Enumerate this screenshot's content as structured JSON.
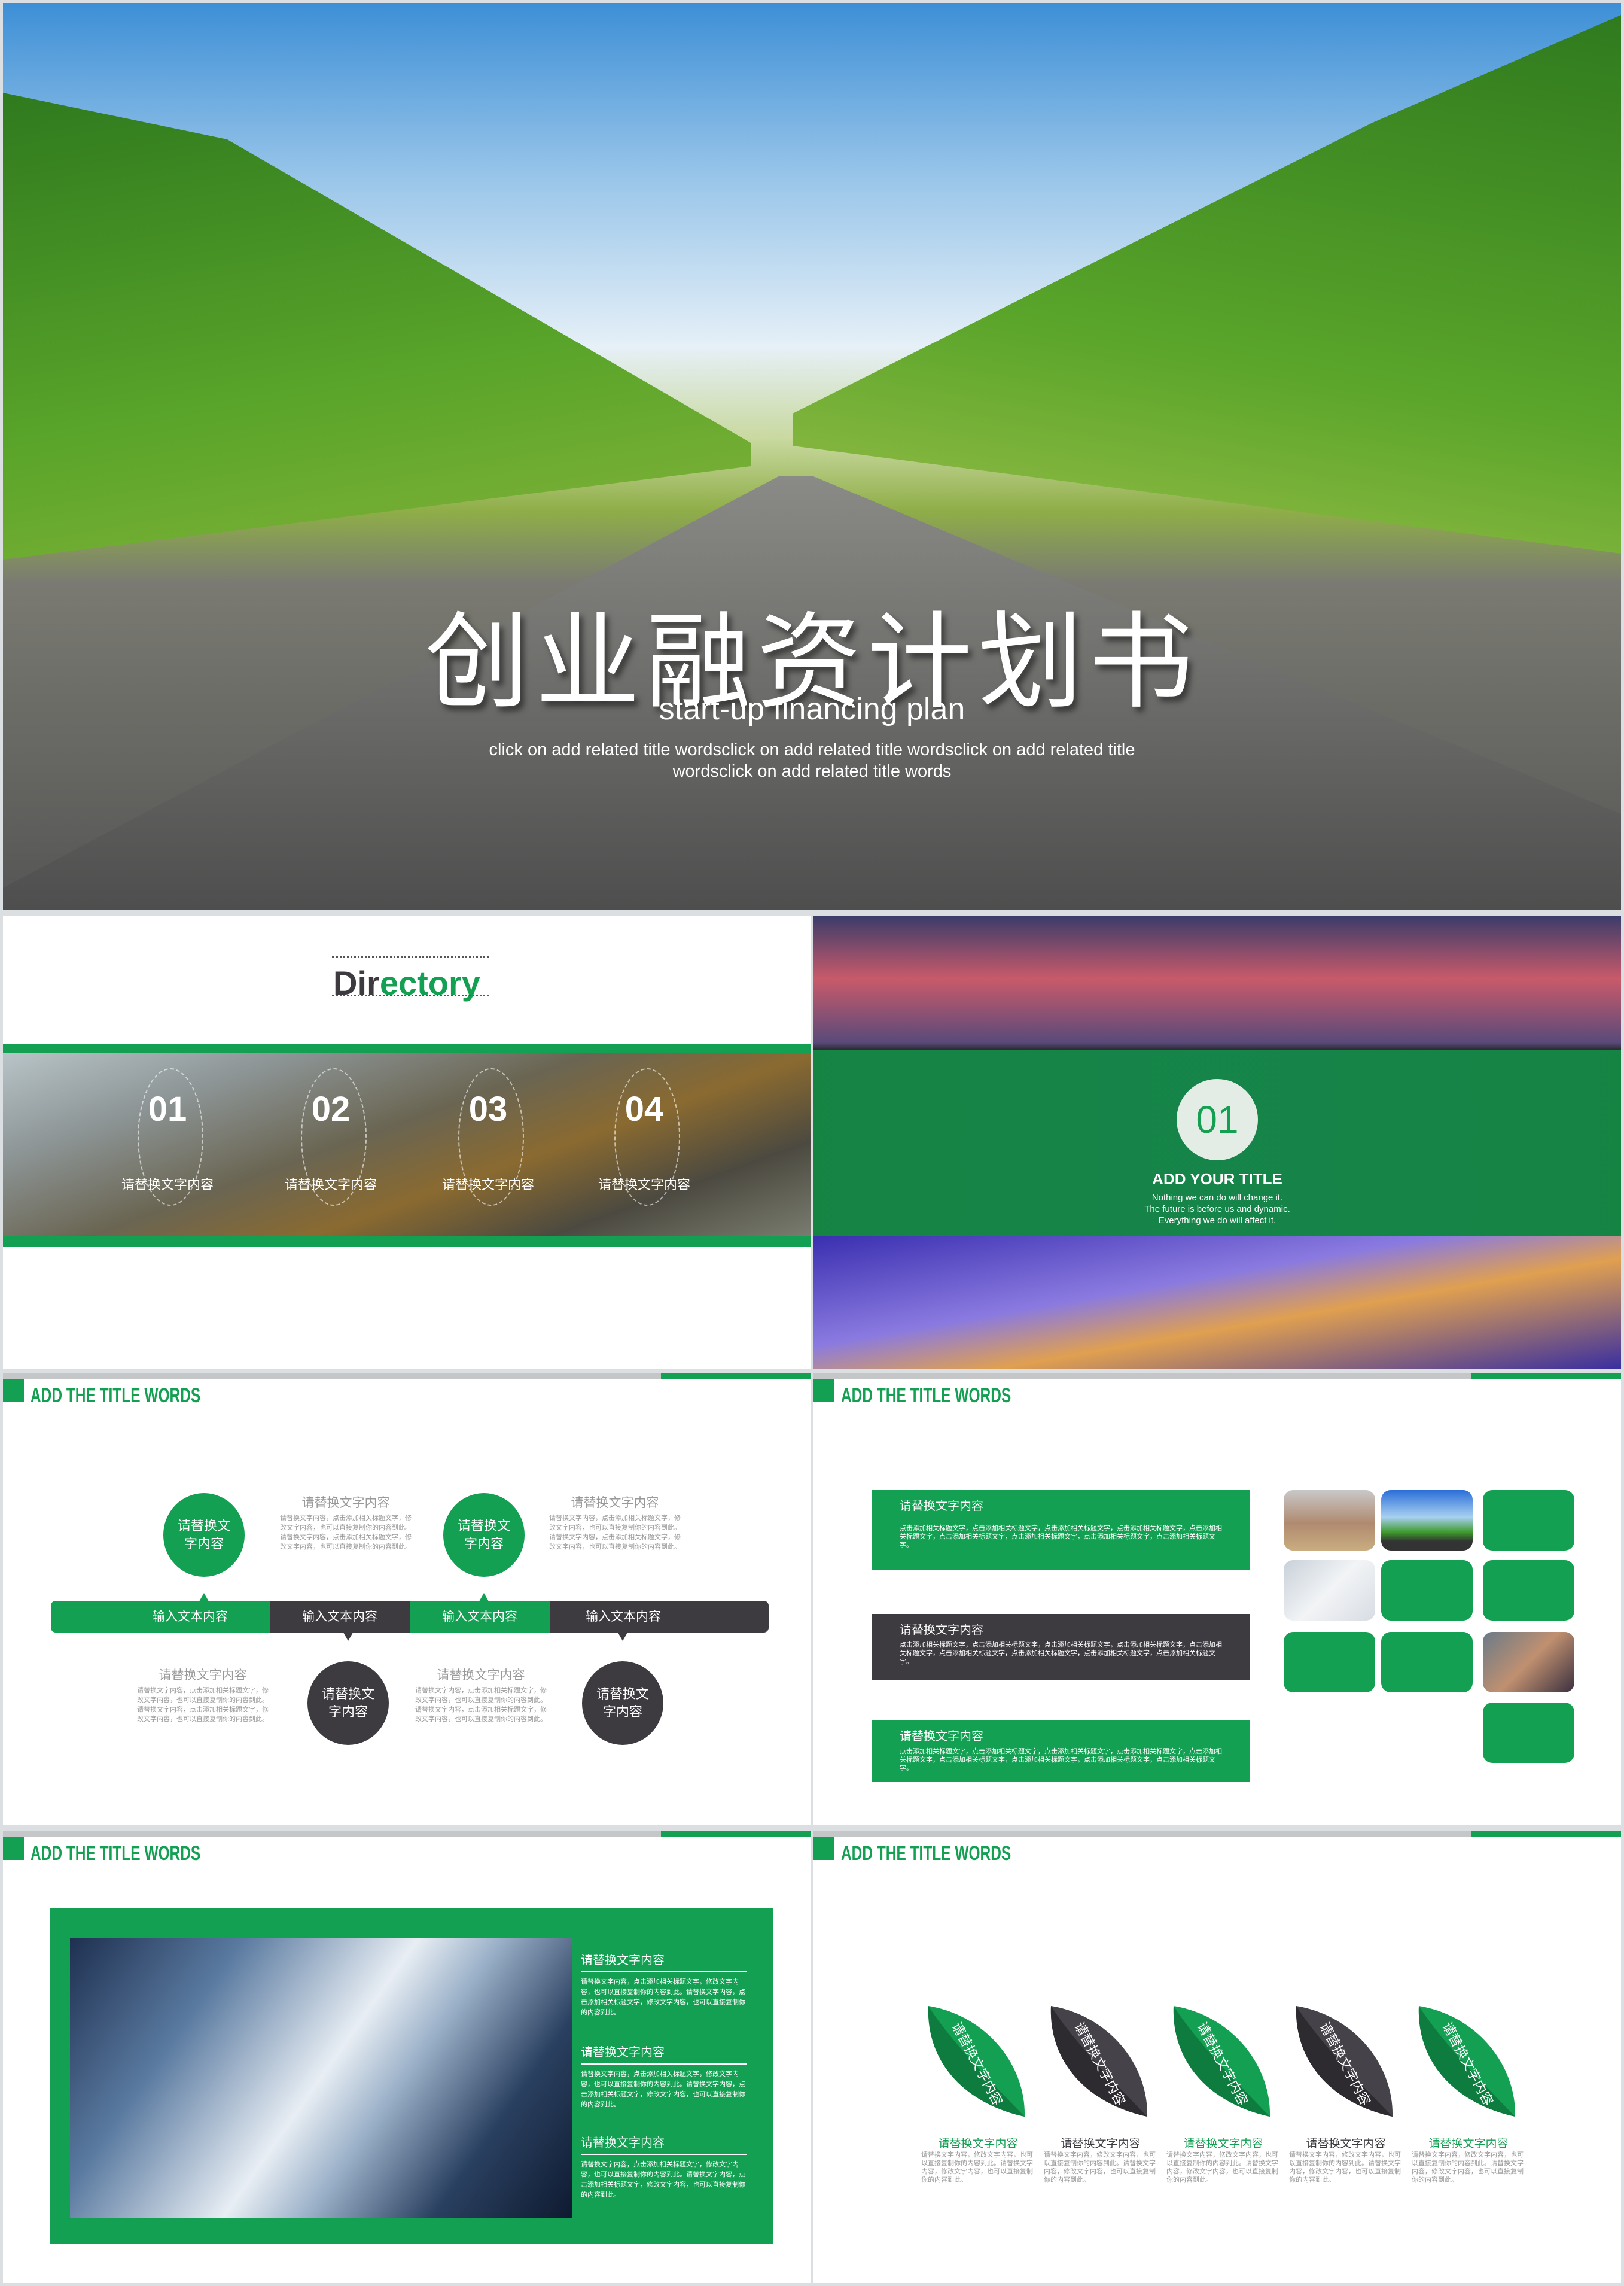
{
  "colors": {
    "accent": "#14a052",
    "dark": "#3e3b40",
    "gray_text": "#999999"
  },
  "cover": {
    "title": "创业融资计划书",
    "subtitle": "start-up financing plan",
    "body_line1": "click on add related title wordsclick on add related title wordsclick on add related title",
    "body_line2": "wordsclick on add related title words"
  },
  "directory": {
    "heading_dark": "Dir",
    "heading_green": "ectory",
    "items": [
      {
        "num": "01",
        "label": "请替换文字内容"
      },
      {
        "num": "02",
        "label": "请替换文字内容"
      },
      {
        "num": "03",
        "label": "请替换文字内容"
      },
      {
        "num": "04",
        "label": "请替换文字内容"
      }
    ]
  },
  "section": {
    "num": "01",
    "title": "ADD YOUR TITLE",
    "lines": [
      "Nothing we can do will change it.",
      "The future is before us and dynamic.",
      "Everything we do will affect it."
    ]
  },
  "timeline": {
    "header": "ADD THE TITLE WORDS",
    "circles_top": [
      "请替换文字内容",
      "请替换文字内容"
    ],
    "circles_bottom": [
      "请替换文字内容",
      "请替换文字内容"
    ],
    "bar_labels": [
      "输入文本内容",
      "输入文本内容",
      "输入文本内容",
      "输入文本内容"
    ],
    "blocks": [
      {
        "title": "请替换文字内容",
        "body": "请替换文字内容，点击添加相关标题文字，修改文字内容，也可以直接复制你的内容到此。请替换文字内容，点击添加相关标题文字，修改文字内容，也可以直接复制你的内容到此。"
      },
      {
        "title": "请替换文字内容",
        "body": "请替换文字内容，点击添加相关标题文字，修改文字内容，也可以直接复制你的内容到此。请替换文字内容，点击添加相关标题文字，修改文字内容，也可以直接复制你的内容到此。"
      },
      {
        "title": "请替换文字内容",
        "body": "请替换文字内容，点击添加相关标题文字，修改文字内容，也可以直接复制你的内容到此。请替换文字内容，点击添加相关标题文字，修改文字内容，也可以直接复制你的内容到此。"
      },
      {
        "title": "请替换文字内容",
        "body": "请替换文字内容，点击添加相关标题文字，修改文字内容，也可以直接复制你的内容到此。请替换文字内容，点击添加相关标题文字，修改文字内容，也可以直接复制你的内容到此。"
      }
    ]
  },
  "boxes": {
    "header": "ADD THE TITLE WORDS",
    "items": [
      {
        "title": "请替换文字内容",
        "body": "点击添加相关标题文字，点击添加相关标题文字，点击添加相关标题文字，点击添加相关标题文字，点击添加相关标题文字，点击添加相关标题文字，点击添加相关标题文字，点击添加相关标题文字，点击添加相关标题文字。"
      },
      {
        "title": "请替换文字内容",
        "body": "点击添加相关标题文字，点击添加相关标题文字，点击添加相关标题文字，点击添加相关标题文字，点击添加相关标题文字，点击添加相关标题文字，点击添加相关标题文字，点击添加相关标题文字，点击添加相关标题文字。"
      },
      {
        "title": "请替换文字内容",
        "body": "点击添加相关标题文字，点击添加相关标题文字，点击添加相关标题文字，点击添加相关标题文字，点击添加相关标题文字，点击添加相关标题文字，点击添加相关标题文字，点击添加相关标题文字，点击添加相关标题文字。"
      }
    ]
  },
  "photo_slide": {
    "header": "ADD THE TITLE WORDS",
    "items": [
      {
        "title": "请替换文字内容",
        "body": "请替换文字内容，点击添加相关标题文字，修改文字内容，也可以直接复制你的内容到此。请替换文字内容，点击添加相关标题文字，修改文字内容，也可以直接复制你的内容到此。"
      },
      {
        "title": "请替换文字内容",
        "body": "请替换文字内容，点击添加相关标题文字，修改文字内容，也可以直接复制你的内容到此。请替换文字内容，点击添加相关标题文字，修改文字内容，也可以直接复制你的内容到此。"
      },
      {
        "title": "请替换文字内容",
        "body": "请替换文字内容，点击添加相关标题文字，修改文字内容，也可以直接复制你的内容到此。请替换文字内容，点击添加相关标题文字，修改文字内容，也可以直接复制你的内容到此。"
      }
    ]
  },
  "leaves": {
    "header": "ADD THE TITLE WORDS",
    "items": [
      {
        "leaf_text": "请替换文字内容",
        "title": "请替换文字内容",
        "body": "请替换文字内容，修改文字内容，也可以直接复制你的内容到此。请替换文字内容，修改文字内容，也可以直接复制你的内容到此。",
        "color": "green"
      },
      {
        "leaf_text": "请替换文字内容",
        "title": "请替换文字内容",
        "body": "请替换文字内容，修改文字内容，也可以直接复制你的内容到此。请替换文字内容，修改文字内容，也可以直接复制你的内容到此。",
        "color": "dark"
      },
      {
        "leaf_text": "请替换文字内容",
        "title": "请替换文字内容",
        "body": "请替换文字内容，修改文字内容，也可以直接复制你的内容到此。请替换文字内容，修改文字内容，也可以直接复制你的内容到此。",
        "color": "green"
      },
      {
        "leaf_text": "请替换文字内容",
        "title": "请替换文字内容",
        "body": "请替换文字内容，修改文字内容，也可以直接复制你的内容到此。请替换文字内容，修改文字内容，也可以直接复制你的内容到此。",
        "color": "dark"
      },
      {
        "leaf_text": "请替换文字内容",
        "title": "请替换文字内容",
        "body": "请替换文字内容，修改文字内容，也可以直接复制你的内容到此。请替换文字内容，修改文字内容，也可以直接复制你的内容到此。",
        "color": "green"
      }
    ]
  }
}
